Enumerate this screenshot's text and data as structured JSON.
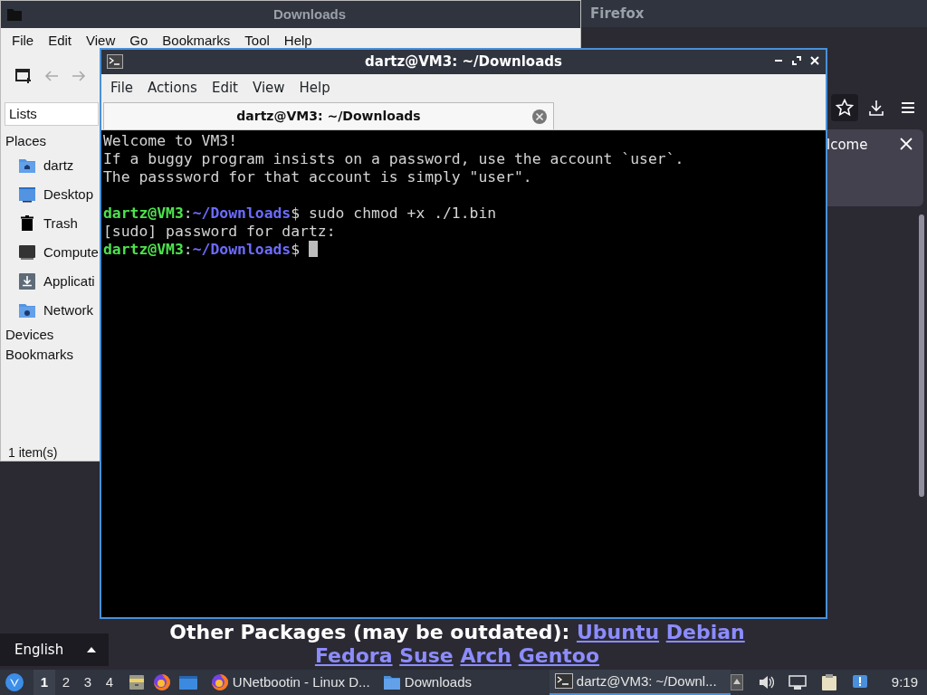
{
  "firefox": {
    "title": "Firefox",
    "notification": "lcome",
    "page": {
      "language": "English",
      "packages_label": "Other Packages (may be outdated):",
      "links": [
        "Ubuntu",
        "Debian",
        "Fedora",
        "Suse",
        "Arch",
        "Gentoo"
      ]
    }
  },
  "file_manager": {
    "title": "Downloads",
    "menu": [
      "File",
      "Edit",
      "View",
      "Go",
      "Bookmarks",
      "Tool",
      "Help"
    ],
    "lists_label": "Lists",
    "sections": [
      {
        "label": "Places",
        "items": [
          {
            "label": "dartz",
            "kind": "home"
          },
          {
            "label": "Desktop",
            "kind": "desktop"
          },
          {
            "label": "Trash",
            "kind": "trash"
          },
          {
            "label": "Compute",
            "kind": "computer"
          },
          {
            "label": "Applicati",
            "kind": "download"
          },
          {
            "label": "Network",
            "kind": "network"
          }
        ]
      },
      {
        "label": "Devices"
      },
      {
        "label": "Bookmarks"
      }
    ],
    "status": "1 item(s)"
  },
  "terminal": {
    "title": "dartz@VM3: ~/Downloads",
    "menu": [
      "File",
      "Actions",
      "Edit",
      "View",
      "Help"
    ],
    "tabs": [
      {
        "label": "dartz@VM3: ~/Downloads",
        "selected": true
      }
    ],
    "lines": [
      {
        "kind": "text",
        "text": "Welcome to VM3!"
      },
      {
        "kind": "text",
        "text": "If a buggy program insists on a password, use the account `user`."
      },
      {
        "kind": "text",
        "text": "The passsword for that account is simply \"user\"."
      },
      {
        "kind": "blank"
      },
      {
        "kind": "prompt",
        "user": "dartz@VM3",
        "separator": ":",
        "path": "~/Downloads",
        "symbol": "$",
        "command": " sudo chmod +x ./1.bin"
      },
      {
        "kind": "text",
        "text": "[sudo] password for dartz:"
      },
      {
        "kind": "prompt",
        "user": "dartz@VM3",
        "separator": ":",
        "path": "~/Downloads",
        "symbol": "$",
        "cursor": true
      }
    ]
  },
  "taskbar": {
    "workspaces": [
      {
        "label": "1",
        "selected": true
      },
      {
        "label": "2",
        "selected": false
      },
      {
        "label": "3",
        "selected": false
      },
      {
        "label": "4",
        "selected": false
      }
    ],
    "tasks": [
      {
        "label": "UNetbootin - Linux D...",
        "kind": "firefox",
        "selected": false
      },
      {
        "label": "Downloads",
        "kind": "folder",
        "selected": false
      },
      {
        "label": "dartz@VM3: ~/Downl...",
        "kind": "terminal",
        "selected": true
      }
    ],
    "clock": "9:19"
  }
}
